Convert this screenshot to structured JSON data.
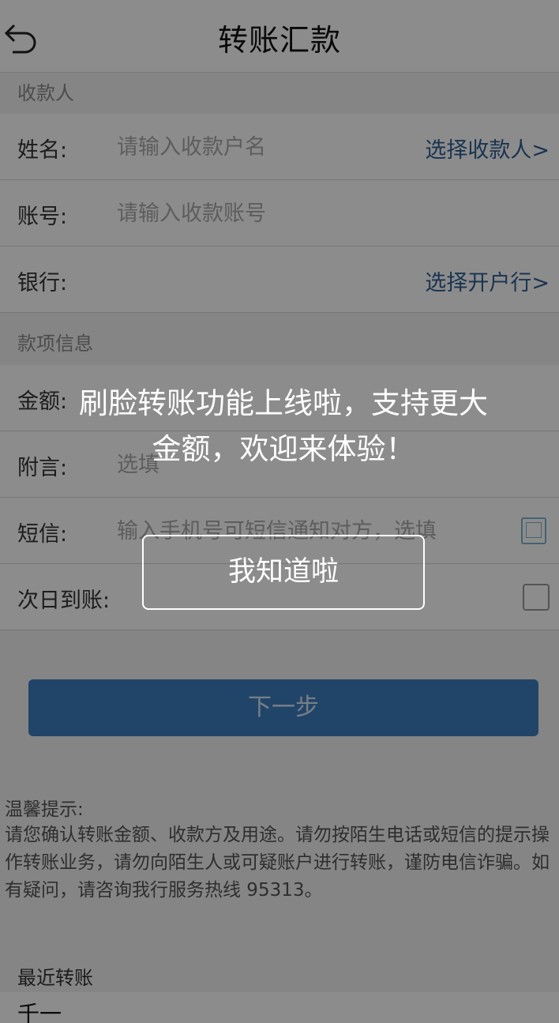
{
  "header": {
    "title": "转账汇款"
  },
  "payee_section": {
    "label": "收款人",
    "name": {
      "label": "姓名:",
      "placeholder": "请输入收款户名",
      "link": "选择收款人>"
    },
    "account": {
      "label": "账号:",
      "placeholder": "请输入收款账号"
    },
    "bank": {
      "label": "银行:",
      "link": "选择开户行>"
    }
  },
  "payment_section": {
    "label": "款项信息",
    "amount": {
      "label": "金额:",
      "placeholder": ""
    },
    "memo": {
      "label": "附言:",
      "placeholder": "选填"
    },
    "sms": {
      "label": "短信:",
      "placeholder": "输入手机号可短信通知对方，选填"
    },
    "next_day": {
      "label": "次日到账:"
    }
  },
  "next_button": {
    "label": "下一步"
  },
  "tips": {
    "title": "温馨提示:",
    "body": "请您确认转账金额、收款方及用途。请勿按陌生电话或短信的提示操作转账业务，请勿向陌生人或可疑账户进行转账，谨防电信诈骗。如有疑问，请咨询我行服务热线 95313。"
  },
  "recent": {
    "label": "最近转账",
    "first_name": "千一"
  },
  "overlay": {
    "line1": "刷脸转账功能上线啦，支持更大",
    "line2": "金额，欢迎来体验！",
    "button": "我知道啦"
  },
  "colors": {
    "link": "#2f5f93",
    "button": "#3d7fbf",
    "overlay": "rgba(0,0,0,0.45)"
  }
}
